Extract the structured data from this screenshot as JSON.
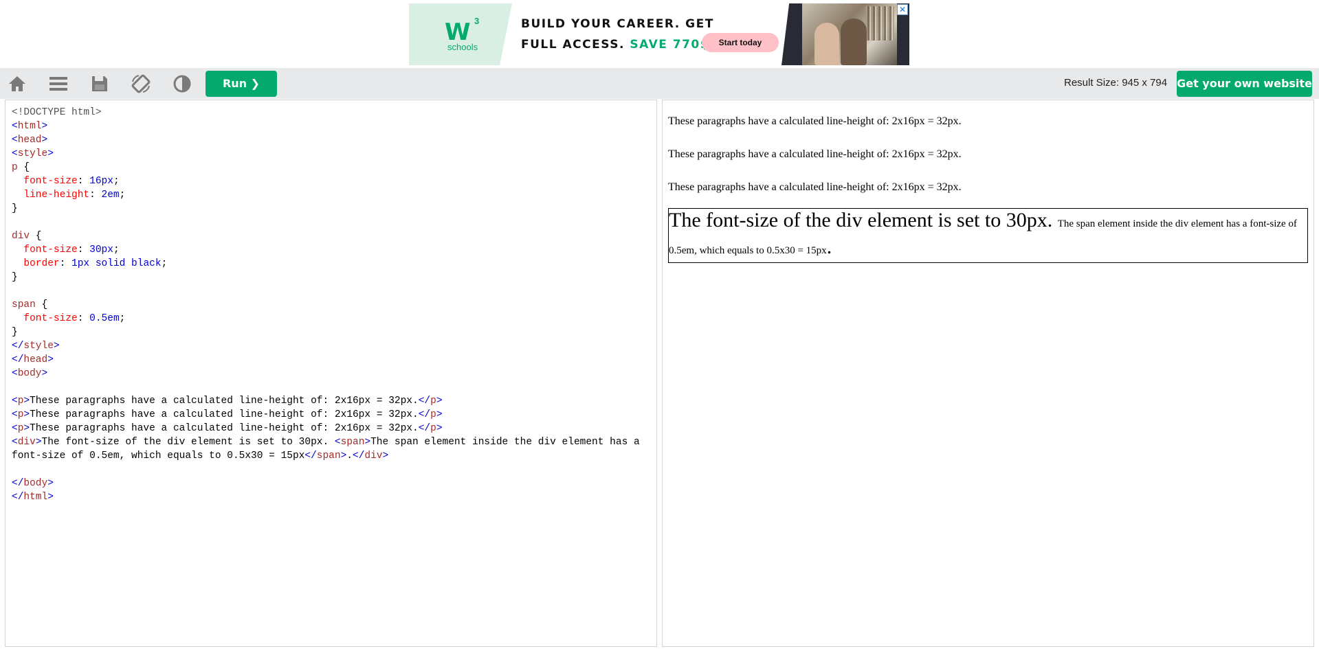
{
  "ad": {
    "logo_mark": "W",
    "logo_sup": "3",
    "logo_text": "schools",
    "headline_line1": "BUILD YOUR CAREER. GET",
    "headline_line2_plain": "FULL ACCESS.",
    "headline_line2_accent": "SAVE 770$",
    "cta_label": "Start today",
    "close_label": "✕"
  },
  "toolbar": {
    "icons": [
      "home-icon",
      "menu-icon",
      "save-icon",
      "rotate-icon",
      "contrast-icon"
    ],
    "run_label": "Run ❯",
    "result_size": "Result Size: 945 x 794",
    "get_website_label": "Get your own website"
  },
  "editor": {
    "lines": [
      [
        [
          "t-doc",
          "<!DOCTYPE html>"
        ]
      ],
      [
        [
          "t-br",
          "<"
        ],
        [
          "t-tag",
          "html"
        ],
        [
          "t-br",
          ">"
        ]
      ],
      [
        [
          "t-br",
          "<"
        ],
        [
          "t-tag",
          "head"
        ],
        [
          "t-br",
          ">"
        ]
      ],
      [
        [
          "t-br",
          "<"
        ],
        [
          "t-tag",
          "style"
        ],
        [
          "t-br",
          ">"
        ]
      ],
      [
        [
          "t-sel",
          "p"
        ],
        [
          "t-plain",
          " {"
        ]
      ],
      [
        [
          "t-plain",
          "  "
        ],
        [
          "t-prop",
          "font-size"
        ],
        [
          "t-plain",
          ": "
        ],
        [
          "t-val",
          "16px"
        ],
        [
          "t-plain",
          ";"
        ]
      ],
      [
        [
          "t-plain",
          "  "
        ],
        [
          "t-prop",
          "line-height"
        ],
        [
          "t-plain",
          ": "
        ],
        [
          "t-val",
          "2em"
        ],
        [
          "t-plain",
          ";"
        ]
      ],
      [
        [
          "t-plain",
          "}"
        ]
      ],
      [
        [
          "t-plain",
          ""
        ]
      ],
      [
        [
          "t-sel",
          "div"
        ],
        [
          "t-plain",
          " {"
        ]
      ],
      [
        [
          "t-plain",
          "  "
        ],
        [
          "t-prop",
          "font-size"
        ],
        [
          "t-plain",
          ": "
        ],
        [
          "t-val",
          "30px"
        ],
        [
          "t-plain",
          ";"
        ]
      ],
      [
        [
          "t-plain",
          "  "
        ],
        [
          "t-prop",
          "border"
        ],
        [
          "t-plain",
          ": "
        ],
        [
          "t-val",
          "1px solid black"
        ],
        [
          "t-plain",
          ";"
        ]
      ],
      [
        [
          "t-plain",
          "}"
        ]
      ],
      [
        [
          "t-plain",
          ""
        ]
      ],
      [
        [
          "t-sel",
          "span"
        ],
        [
          "t-plain",
          " {"
        ]
      ],
      [
        [
          "t-plain",
          "  "
        ],
        [
          "t-prop",
          "font-size"
        ],
        [
          "t-plain",
          ": "
        ],
        [
          "t-val",
          "0.5em"
        ],
        [
          "t-plain",
          ";"
        ]
      ],
      [
        [
          "t-plain",
          "}"
        ]
      ],
      [
        [
          "t-br",
          "</"
        ],
        [
          "t-tag",
          "style"
        ],
        [
          "t-br",
          ">"
        ]
      ],
      [
        [
          "t-br",
          "</"
        ],
        [
          "t-tag",
          "head"
        ],
        [
          "t-br",
          ">"
        ]
      ],
      [
        [
          "t-br",
          "<"
        ],
        [
          "t-tag",
          "body"
        ],
        [
          "t-br",
          ">"
        ]
      ],
      [
        [
          "t-plain",
          ""
        ]
      ],
      [
        [
          "t-br",
          "<"
        ],
        [
          "t-tag",
          "p"
        ],
        [
          "t-br",
          ">"
        ],
        [
          "t-plain",
          "These paragraphs have a calculated line-height of: 2x16px = 32px."
        ],
        [
          "t-br",
          "</"
        ],
        [
          "t-tag",
          "p"
        ],
        [
          "t-br",
          ">"
        ]
      ],
      [
        [
          "t-br",
          "<"
        ],
        [
          "t-tag",
          "p"
        ],
        [
          "t-br",
          ">"
        ],
        [
          "t-plain",
          "These paragraphs have a calculated line-height of: 2x16px = 32px."
        ],
        [
          "t-br",
          "</"
        ],
        [
          "t-tag",
          "p"
        ],
        [
          "t-br",
          ">"
        ]
      ],
      [
        [
          "t-br",
          "<"
        ],
        [
          "t-tag",
          "p"
        ],
        [
          "t-br",
          ">"
        ],
        [
          "t-plain",
          "These paragraphs have a calculated line-height of: 2x16px = 32px."
        ],
        [
          "t-br",
          "</"
        ],
        [
          "t-tag",
          "p"
        ],
        [
          "t-br",
          ">"
        ]
      ],
      [
        [
          "t-br",
          "<"
        ],
        [
          "t-tag",
          "div"
        ],
        [
          "t-br",
          ">"
        ],
        [
          "t-plain",
          "The font-size of the div element is set to 30px. "
        ],
        [
          "t-br",
          "<"
        ],
        [
          "t-tag",
          "span"
        ],
        [
          "t-br",
          ">"
        ],
        [
          "t-plain",
          "The span element inside the div element has a font-size of 0.5em, which equals to 0.5x30 = 15px"
        ],
        [
          "t-br",
          "</"
        ],
        [
          "t-tag",
          "span"
        ],
        [
          "t-br",
          ">"
        ],
        [
          "t-plain",
          "."
        ],
        [
          "t-br",
          "</"
        ],
        [
          "t-tag",
          "div"
        ],
        [
          "t-br",
          ">"
        ]
      ],
      [
        [
          "t-plain",
          ""
        ]
      ],
      [
        [
          "t-br",
          "</"
        ],
        [
          "t-tag",
          "body"
        ],
        [
          "t-br",
          ">"
        ]
      ],
      [
        [
          "t-br",
          "</"
        ],
        [
          "t-tag",
          "html"
        ],
        [
          "t-br",
          ">"
        ]
      ]
    ]
  },
  "result": {
    "paragraphs": [
      "These paragraphs have a calculated line-height of: 2x16px = 32px.",
      "These paragraphs have a calculated line-height of: 2x16px = 32px.",
      "These paragraphs have a calculated line-height of: 2x16px = 32px."
    ],
    "div_text": "The font-size of the div element is set to 30px. ",
    "span_text": "The span element inside the div element has a font-size of 0.5em, which equals to 0.5x30 = 15px",
    "div_tail": "."
  },
  "colors": {
    "accent": "#04aa6d",
    "toolbar_bg": "#e7e9eb"
  }
}
